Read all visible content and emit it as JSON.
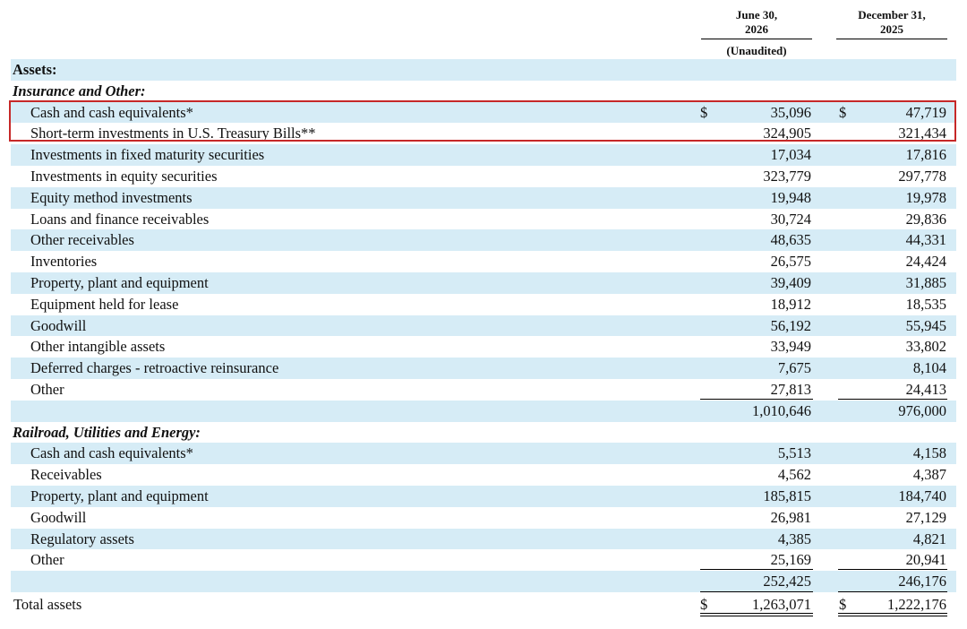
{
  "columns": [
    {
      "line1": "June 30,",
      "line2": "2026",
      "note": "(Unaudited)"
    },
    {
      "line1": "December 31,",
      "line2": "2025"
    }
  ],
  "currency_symbol": "$",
  "assets_heading": "Assets:",
  "sections": [
    {
      "title": "Insurance and Other:",
      "rows": [
        {
          "label": "Cash and cash equivalents*",
          "v1": "35,096",
          "v2": "47,719",
          "dollar": true,
          "highlighted": true
        },
        {
          "label": "Short-term investments in U.S. Treasury Bills**",
          "v1": "324,905",
          "v2": "321,434",
          "highlighted": true
        },
        {
          "label": "Investments in fixed maturity securities",
          "v1": "17,034",
          "v2": "17,816"
        },
        {
          "label": "Investments in equity securities",
          "v1": "323,779",
          "v2": "297,778"
        },
        {
          "label": "Equity method investments",
          "v1": "19,948",
          "v2": "19,978"
        },
        {
          "label": "Loans and finance receivables",
          "v1": "30,724",
          "v2": "29,836"
        },
        {
          "label": "Other receivables",
          "v1": "48,635",
          "v2": "44,331"
        },
        {
          "label": "Inventories",
          "v1": "26,575",
          "v2": "24,424"
        },
        {
          "label": "Property, plant and equipment",
          "v1": "39,409",
          "v2": "31,885"
        },
        {
          "label": "Equipment held for lease",
          "v1": "18,912",
          "v2": "18,535"
        },
        {
          "label": "Goodwill",
          "v1": "56,192",
          "v2": "55,945"
        },
        {
          "label": "Other intangible assets",
          "v1": "33,949",
          "v2": "33,802"
        },
        {
          "label": "Deferred charges - retroactive reinsurance",
          "v1": "7,675",
          "v2": "8,104"
        },
        {
          "label": "Other",
          "v1": "27,813",
          "v2": "24,413"
        }
      ],
      "subtotal": {
        "v1": "1,010,646",
        "v2": "976,000"
      }
    },
    {
      "title": "Railroad, Utilities and Energy:",
      "rows": [
        {
          "label": "Cash and cash equivalents*",
          "v1": "5,513",
          "v2": "4,158"
        },
        {
          "label": "Receivables",
          "v1": "4,562",
          "v2": "4,387"
        },
        {
          "label": "Property, plant and equipment",
          "v1": "185,815",
          "v2": "184,740"
        },
        {
          "label": "Goodwill",
          "v1": "26,981",
          "v2": "27,129"
        },
        {
          "label": "Regulatory assets",
          "v1": "4,385",
          "v2": "4,821"
        },
        {
          "label": "Other",
          "v1": "25,169",
          "v2": "20,941"
        }
      ],
      "subtotal": {
        "v1": "252,425",
        "v2": "246,176"
      }
    }
  ],
  "total": {
    "label": "Total assets",
    "v1": "1,263,071",
    "v2": "1,222,176"
  },
  "colors": {
    "row_shade": "#d6ecf6",
    "highlight_border": "#c62828"
  }
}
